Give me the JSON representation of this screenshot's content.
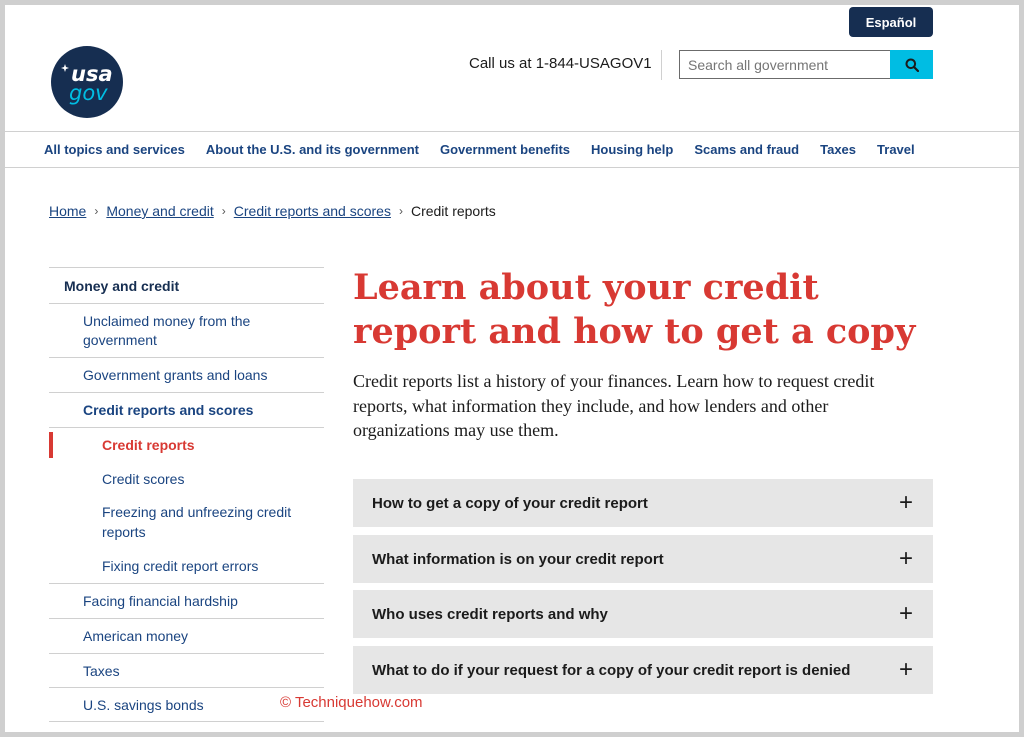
{
  "header": {
    "language_button": "Español",
    "logo": {
      "line1": "usa",
      "line2": "gov"
    },
    "call_us": "Call us at 1-844-USAGOV1",
    "search": {
      "placeholder": "Search all government",
      "icon": "search-icon"
    }
  },
  "nav": {
    "items": [
      "All topics and services",
      "About the U.S. and its government",
      "Government benefits",
      "Housing help",
      "Scams and fraud",
      "Taxes",
      "Travel"
    ]
  },
  "breadcrumb": {
    "items": [
      "Home",
      "Money and credit",
      "Credit reports and scores"
    ],
    "current": "Credit reports",
    "separator": "›"
  },
  "sidebar": {
    "heading": "Money and credit",
    "items": [
      {
        "label": "Unclaimed money from the government"
      },
      {
        "label": "Government grants and loans"
      },
      {
        "label": "Credit reports and scores"
      },
      {
        "label": "Credit reports"
      },
      {
        "label": "Credit scores"
      },
      {
        "label": "Freezing and unfreezing credit reports"
      },
      {
        "label": "Fixing credit report errors"
      },
      {
        "label": "Facing financial hardship"
      },
      {
        "label": "American money"
      },
      {
        "label": "Taxes"
      },
      {
        "label": "U.S. savings bonds"
      }
    ]
  },
  "main": {
    "title": "Learn about your credit report and how to get a copy",
    "intro": "Credit reports list a history of your finances. Learn how to request credit reports, what information they include, and how lenders and other organizations may use them.",
    "accordions": [
      "How to get a copy of your credit report",
      "What information is on your credit report",
      "Who uses credit reports and why",
      "What to do if your request for a copy of your credit report is denied"
    ],
    "expand_symbol": "+"
  },
  "watermark": "© Techniquehow.com",
  "colors": {
    "accent_red": "#d83933",
    "navy": "#162e51",
    "link": "#1a4480",
    "search_button": "#00bde3"
  }
}
